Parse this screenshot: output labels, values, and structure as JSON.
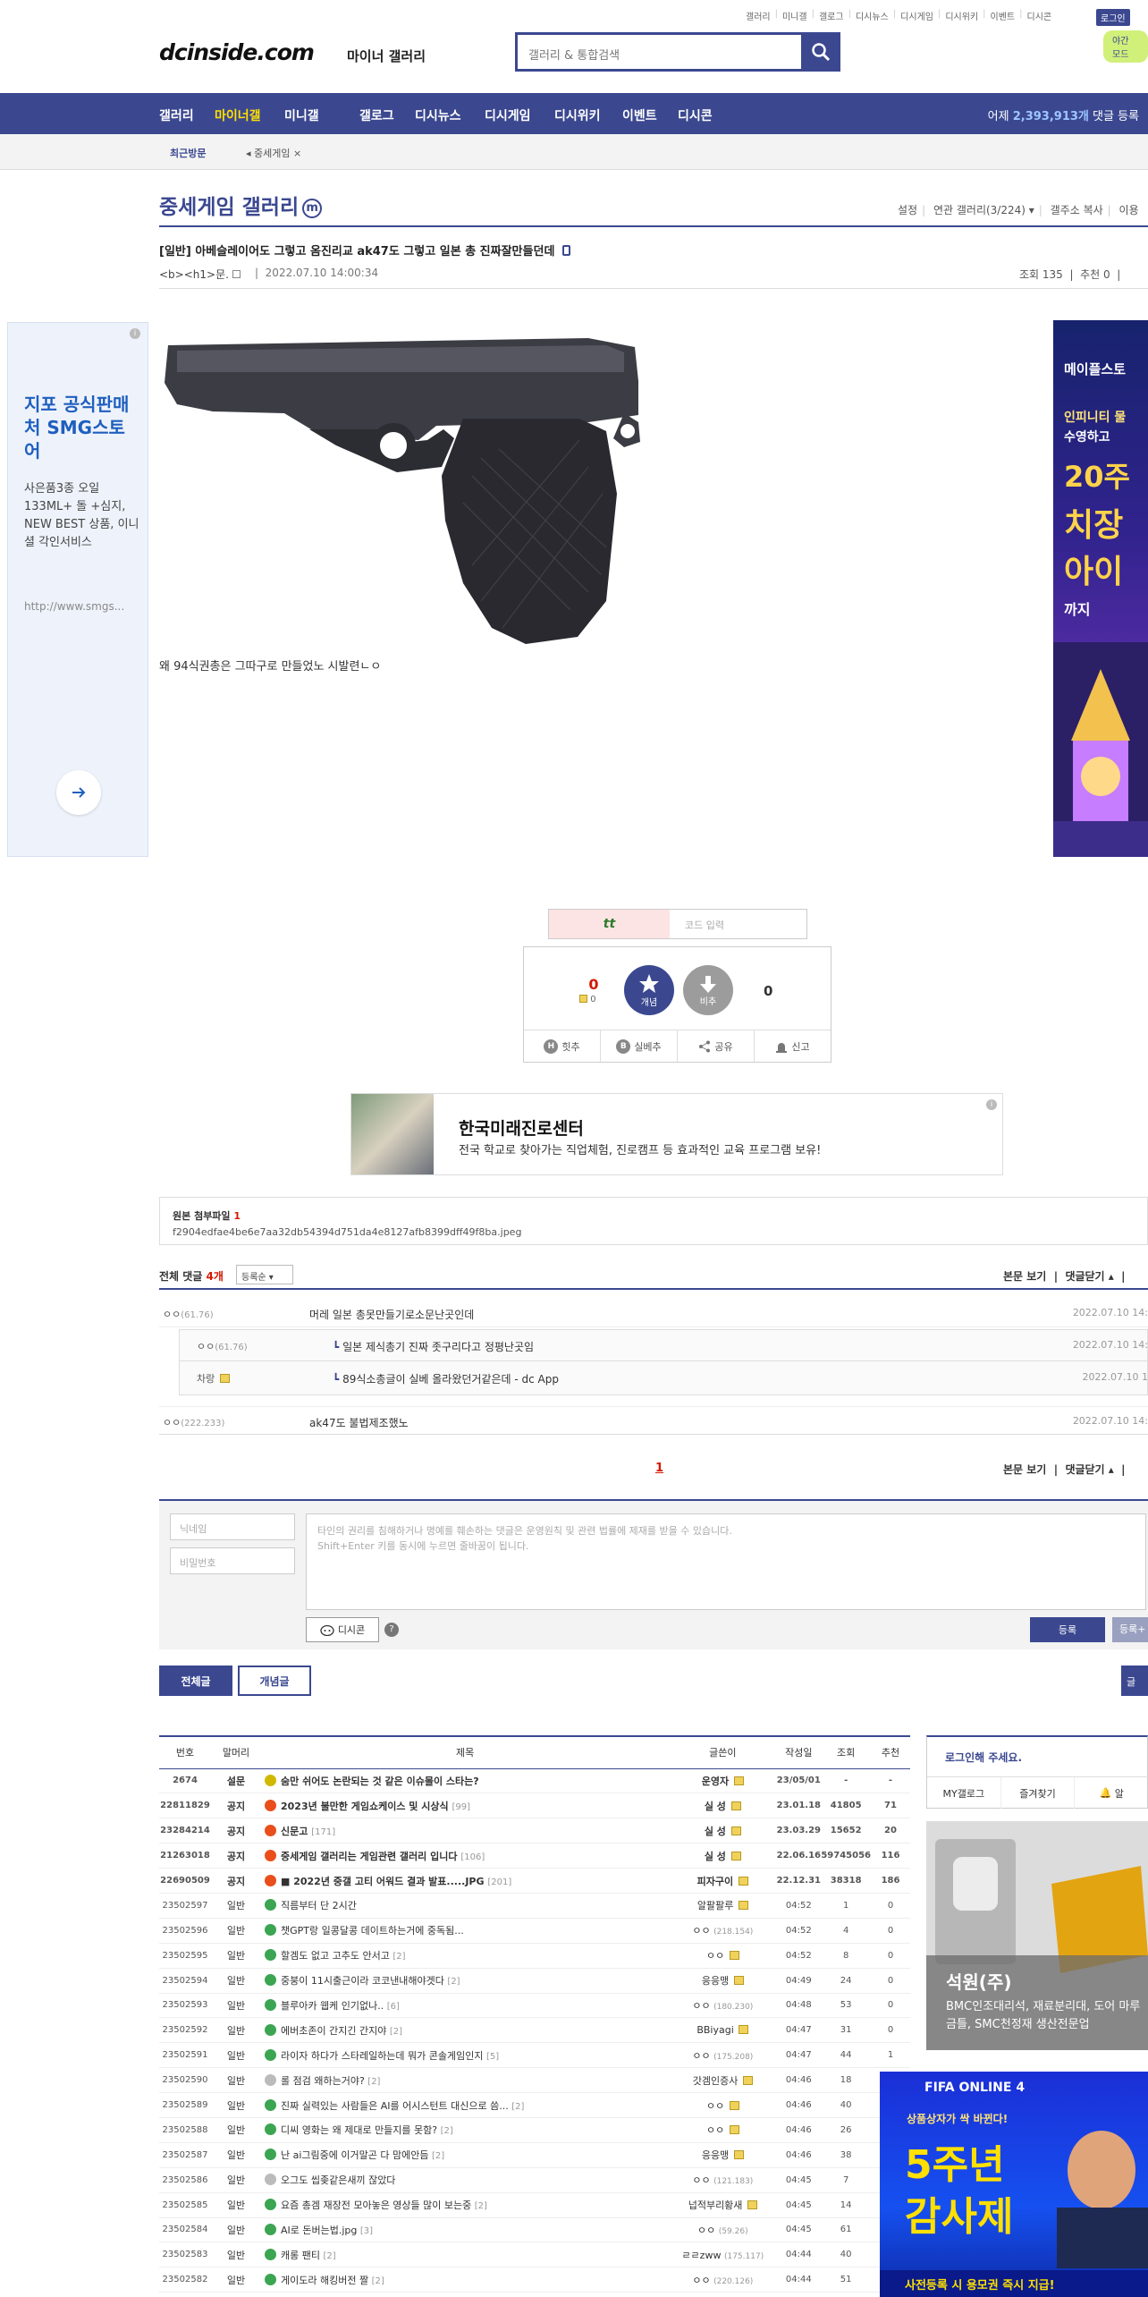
{
  "top_links": [
    "갤러리",
    "미니갤",
    "갤로그",
    "디시뉴스",
    "디시게임",
    "디시위키",
    "이벤트",
    "디시콘"
  ],
  "login_label": "로그인",
  "my_label": "야간 모드",
  "logo": {
    "text": "dcinside.com",
    "sub": "마이너 갤러리"
  },
  "search": {
    "placeholder": "갤러리 & 통합검색"
  },
  "gnb": {
    "items": [
      "갤러리",
      "마이너갤",
      "미니갤",
      "갤로그",
      "디시뉴스",
      "디시게임",
      "디시위키",
      "이벤트",
      "디시콘"
    ],
    "visitor_prefix": "어제",
    "visitor_count": "2,393,913개",
    "visitor_suffix": "댓글 등록"
  },
  "visit_bar": {
    "label": "최근방문",
    "item": "중세게임"
  },
  "gallery": {
    "title": "중세게임 갤러리",
    "mark": "m",
    "tools": [
      "설정",
      "연관 갤러리(3/224)",
      "갤주소 복사",
      "이용"
    ]
  },
  "post": {
    "title": "[일반] 아베슬레이어도 그렇고 옴진리교 ak47도 그렇고 일본 총 진짜잘만들던데",
    "writer": "<b><h1>문.",
    "date": "2022.07.10 14:00:34",
    "views_label": "조회 135",
    "recommend_label": "추천 0",
    "body_text": "왜 94식권총은 그따구로 만들었노 시발련ㄴㅇ"
  },
  "left_ad": {
    "headline": "지포 공식판매처 SMG스토어",
    "desc": "사은품3종 오일133ML+ 돌 +심지, NEW BEST 상품, 이니셜 각인서비스",
    "url": "http://www.smgs..."
  },
  "right_ad": {
    "lines": [
      "메이플스토",
      "인피니티 물",
      "수영하고",
      "20주",
      "치장",
      "아이",
      "까지"
    ]
  },
  "captcha": {
    "code": "tt",
    "placeholder": "코드 입력"
  },
  "recommend": {
    "up_count": "0",
    "fix_count": "0",
    "star_label": "개념",
    "down_label": "비추",
    "down_count": "0",
    "actions": [
      "힛추",
      "실베추",
      "공유",
      "신고"
    ]
  },
  "banner_ad": {
    "title": "한국미래진로센터",
    "desc": "전국 학교로 찾아가는 직업체험, 진로캠프 등 효과적인 교육 프로그램 보유!"
  },
  "attachment": {
    "label": "원본 첨부파일",
    "count": "1",
    "filename": "f2904edfae4be6e7aa32db54394d751da4e8127afb8399dff49f8ba.jpeg"
  },
  "comments": {
    "label": "전체 댓글",
    "count": "4개",
    "sort": "등록순",
    "view_body": "본문 보기",
    "close": "댓글닫기",
    "items": [
      {
        "name": "ㅇㅇ",
        "ip": "(61.76)",
        "text": "머레 일본 총못만들기로소문난곳인데",
        "date": "2022.07.10 14:"
      },
      {
        "name": "ㅇㅇ",
        "ip": "(61.76)",
        "text": "일본 제식총기 진짜 좃구리다고 정평난곳임",
        "date": "2022.07.10 14:"
      },
      {
        "name": "차랑",
        "ip": "",
        "text": "89식소총글이 실베 올라왔던거같은데 - dc App",
        "date": "2022.07.10 1"
      },
      {
        "name": "ㅇㅇ",
        "ip": "(222.233)",
        "text": "ak47도 불법제조했노",
        "date": "2022.07.10 14:"
      }
    ],
    "page": "1"
  },
  "write": {
    "nick_placeholder": "닉네임",
    "pw_placeholder": "비밀번호",
    "text_placeholder_1": "타인의 권리를 침해하거나 명예를 훼손하는 댓글은 운영원칙 및 관련 법률에 제재를 받을 수 있습니다.",
    "text_placeholder_2": "Shift+Enter 키를 동시에 누르면 줄바꿈이 됩니다.",
    "dccon_label": "디시콘",
    "help": "?",
    "submit": "등록",
    "submit2": "등록+"
  },
  "list_tabs": {
    "all": "전체글",
    "best": "개념글",
    "right": "글"
  },
  "list": {
    "headers": [
      "번호",
      "말머리",
      "제목",
      "글쓴이",
      "작성일",
      "조회",
      "추천"
    ],
    "rows": [
      {
        "no": "2674",
        "head": "설문",
        "icon": "yel",
        "title": "숨만 쉬어도 논란되는 것 같은 이슈몰이 스타는?",
        "cc": "",
        "writer": "운영자",
        "wip": "",
        "date": "23/05/01",
        "views": "-",
        "rec": "-",
        "notice": true
      },
      {
        "no": "22811829",
        "head": "공지",
        "icon": "red",
        "title": "2023년 불만한 게임쇼케이스 및 시상식",
        "cc": "[99]",
        "writer": "실 성",
        "wip": "",
        "date": "23.01.18",
        "views": "41805",
        "rec": "71",
        "notice": true
      },
      {
        "no": "23284214",
        "head": "공지",
        "icon": "red",
        "title": "신문고",
        "cc": "[171]",
        "writer": "실 성",
        "wip": "",
        "date": "23.03.29",
        "views": "15652",
        "rec": "20",
        "notice": true
      },
      {
        "no": "21263018",
        "head": "공지",
        "icon": "red",
        "title": "중세게임 갤러리는 게임관련 갤러리 입니다",
        "cc": "[106]",
        "writer": "실 성",
        "wip": "",
        "date": "22.06.16",
        "views": "59745056",
        "rec": "116",
        "notice": true
      },
      {
        "no": "22690509",
        "head": "공지",
        "icon": "red",
        "title": "■ 2022년 중갤 고티 어워드 결과 발표.....JPG",
        "cc": "[201]",
        "writer": "피자구이",
        "wip": "",
        "date": "22.12.31",
        "views": "38318",
        "rec": "186",
        "notice": true
      },
      {
        "no": "23502597",
        "head": "일반",
        "icon": "grn",
        "title": "직름부터 단 2시간",
        "cc": "",
        "writer": "알팔팔루",
        "wip": "",
        "date": "04:52",
        "views": "1",
        "rec": "0",
        "notice": false
      },
      {
        "no": "23502596",
        "head": "일반",
        "icon": "grn",
        "title": "챗GPT랑 일콩달콩 데이트하는거에 중독됨...",
        "cc": "",
        "writer": "ㅇㅇ",
        "wip": "(218.154)",
        "date": "04:52",
        "views": "4",
        "rec": "0",
        "notice": false
      },
      {
        "no": "23502595",
        "head": "일반",
        "icon": "grn",
        "title": "할겜도 없고 고추도 안서고",
        "cc": "[2]",
        "writer": "ㅇㅇ",
        "wip": "",
        "date": "04:52",
        "views": "8",
        "rec": "0",
        "notice": false
      },
      {
        "no": "23502594",
        "head": "일반",
        "icon": "grn",
        "title": "중붕이 11시출근이라 코코낸내해야겟다",
        "cc": "[2]",
        "writer": "응응맹",
        "wip": "",
        "date": "04:49",
        "views": "24",
        "rec": "0",
        "notice": false
      },
      {
        "no": "23502593",
        "head": "일반",
        "icon": "grn",
        "title": "블루아카 웹케 인기없나..",
        "cc": "[6]",
        "writer": "ㅇㅇ",
        "wip": "(180.230)",
        "date": "04:48",
        "views": "53",
        "rec": "0",
        "notice": false
      },
      {
        "no": "23502592",
        "head": "일반",
        "icon": "grn",
        "title": "에버초존이 간지긴 간지야",
        "cc": "[2]",
        "writer": "BBiyagi",
        "wip": "",
        "date": "04:47",
        "views": "31",
        "rec": "0",
        "notice": false
      },
      {
        "no": "23502591",
        "head": "일반",
        "icon": "grn",
        "title": "라이자 하다가 스타레일하는데 뭐가 콘솔게임인지",
        "cc": "[5]",
        "writer": "ㅇㅇ",
        "wip": "(175.208)",
        "date": "04:47",
        "views": "44",
        "rec": "1",
        "notice": false
      },
      {
        "no": "23502590",
        "head": "일반",
        "icon": "gry",
        "title": "롤 점검 왜하는거야?",
        "cc": "[2]",
        "writer": "갓겜인증사",
        "wip": "",
        "date": "04:46",
        "views": "18",
        "rec": "0",
        "notice": false
      },
      {
        "no": "23502589",
        "head": "일반",
        "icon": "grn",
        "title": "진짜 실력있는 사람들은 AI를 어시스턴트 대신으로 씀...",
        "cc": "[2]",
        "writer": "ㅇㅇ",
        "wip": "",
        "date": "04:46",
        "views": "40",
        "rec": "0",
        "notice": false
      },
      {
        "no": "23502588",
        "head": "일반",
        "icon": "grn",
        "title": "디씨 영화는 왜 제대로 만들지를 못함?",
        "cc": "[2]",
        "writer": "ㅇㅇ",
        "wip": "",
        "date": "04:46",
        "views": "26",
        "rec": "0",
        "notice": false
      },
      {
        "no": "23502587",
        "head": "일반",
        "icon": "grn",
        "title": "난 ai그림중에 이거말곤 다 맘에안듬",
        "cc": "[2]",
        "writer": "응응맹",
        "wip": "",
        "date": "04:46",
        "views": "38",
        "rec": "0",
        "notice": false
      },
      {
        "no": "23502586",
        "head": "일반",
        "icon": "gry",
        "title": "오그도 씹좆같은새끼 잖았다",
        "cc": "",
        "writer": "ㅇㅇ",
        "wip": "(121.183)",
        "date": "04:45",
        "views": "7",
        "rec": "0",
        "notice": false
      },
      {
        "no": "23502585",
        "head": "일반",
        "icon": "grn",
        "title": "요즘 총겜 재장전 모아놓은 영상들 많이 보는중",
        "cc": "[2]",
        "writer": "넙적부리황새",
        "wip": "",
        "date": "04:45",
        "views": "14",
        "rec": "0",
        "notice": false
      },
      {
        "no": "23502584",
        "head": "일반",
        "icon": "grn",
        "title": "AI로 돈버는법.jpg",
        "cc": "[3]",
        "writer": "ㅇㅇ",
        "wip": "(59.26)",
        "date": "04:45",
        "views": "61",
        "rec": "0",
        "notice": false
      },
      {
        "no": "23502583",
        "head": "일반",
        "icon": "grn",
        "title": "캐롱 팬티",
        "cc": "[2]",
        "writer": "ㄹㄹzww",
        "wip": "(175.117)",
        "date": "04:44",
        "views": "40",
        "rec": "0",
        "notice": false
      },
      {
        "no": "23502582",
        "head": "일반",
        "icon": "grn",
        "title": "게이도라 해킹버전 짤",
        "cc": "[2]",
        "writer": "ㅇㅇ",
        "wip": "(220.126)",
        "date": "04:44",
        "views": "51",
        "rec": "0",
        "notice": false
      }
    ]
  },
  "login_box": {
    "message": "로그인해 주세요.",
    "tabs": [
      "MY갤로그",
      "즐겨찾기",
      "알"
    ]
  },
  "product_ad": {
    "title": "석원(주)",
    "desc": "BMC인조대리석, 재료분리대, 도어 마루금틀, SMC천정재 생산전문업"
  },
  "fifa_ad": {
    "brand": "FIFA ONLINE 4",
    "line1": "상품상자가 싹 바뀐다!",
    "line2": "5주년",
    "line3": "감사제",
    "cta": "사전등록 시 용모권 즉시 지급!"
  }
}
